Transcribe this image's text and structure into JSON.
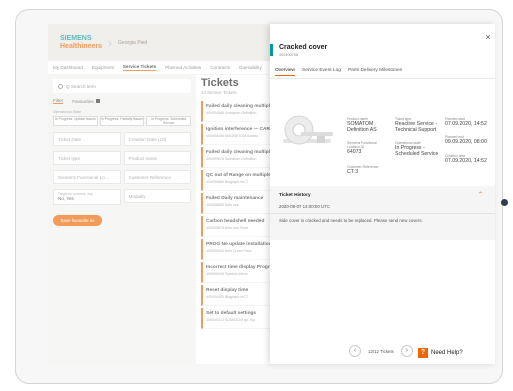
{
  "app": {
    "brand_line1": "SIEMENS",
    "brand_line2": "Healthineers",
    "site": "Georgia Pied"
  },
  "nav": [
    "My Dashboard",
    "Equipment",
    "Service Tickets",
    "Planned Activities",
    "Contracts",
    "Guesability"
  ],
  "nav_active_index": 2,
  "left": {
    "search_placeholder": "Q Search term",
    "filter_tabs": [
      "Filter",
      "Favourites"
    ],
    "operational_state_label": "Operational State",
    "chips": [
      "In Progress: Update Issues",
      "In Progress: Partially Issues",
      "In Progress: Scheduled Service"
    ],
    "fields": [
      [
        "Ticket Date",
        "Creation Date (10)"
      ],
      [
        "Ticket type",
        "Product name"
      ],
      [
        "Siemens Functional Lo...",
        "Customer Reference"
      ],
      [
        "Modality"
      ]
    ],
    "target_field_small": "Target for success, day",
    "target_field_value": "No, Yes",
    "fav_button": "Save favourite as"
  },
  "list": {
    "title": "Tickets",
    "subtitle": "13 Service Tickets",
    "tickets": [
      {
        "title": "Failed daily cleaning multiple...",
        "meta": "400094568   Somatom Definition"
      },
      {
        "title": "Ignition interference — CARD...",
        "meta": "400098208   MAGNETOM Avanto"
      },
      {
        "title": "Failed daily cleaning multiple...",
        "meta": "400099678   Somatom Definition"
      },
      {
        "title": "QC out of Range on multiple...",
        "meta": "400099866   Biograph mCT"
      },
      {
        "title": "Failed Daily maintenance",
        "meta": "400058889   Artis zee"
      },
      {
        "title": "Carbon headshell needed",
        "meta": "400099876   Artis one Floor"
      },
      {
        "title": "PROG No update installation...",
        "meta": "400099943   Artis Q.zen Floor"
      },
      {
        "title": "Incorrect time display Progra...",
        "meta": "400099945   Symbia Intevo"
      },
      {
        "title": "Reset display time",
        "meta": "400050903   Biograph mCT"
      },
      {
        "title": "Set to default settings",
        "meta": "400049213   SOMATOM go.Top"
      }
    ]
  },
  "panel": {
    "title": "Cracked cover",
    "ticket_id": "400100708",
    "close_label": "×",
    "tabs": [
      "Overview",
      "Service Event Log",
      "Parts Delivery Milestones"
    ],
    "active_tab": 0,
    "info": {
      "product_name_label": "Product name",
      "product_name_l1": "SOMATOM",
      "product_name_l2": "Definition AS",
      "ticket_type_label": "Ticket type",
      "ticket_type_l1": "Reactive Service -",
      "ticket_type_l2": "Technical Support",
      "planned_start_label": "Planned start",
      "planned_start": "07.09.2020, 14:52",
      "siemens_loc_label": "Siemens Functional",
      "siemens_loc_label2": "Location ID",
      "siemens_loc": "64073",
      "op_state_label": "Operational state",
      "op_state_l1": "In Progress -",
      "op_state_l2": "Scheduled Service",
      "planned_end_label": "Planned end",
      "planned_end": "09.09.2020, 08:00",
      "creation_time_label": "Creation time",
      "creation_time": "07.09.2020, 14:52",
      "customer_ref_label": "Customer Reference",
      "customer_ref": "CT 3"
    },
    "history": {
      "title": "Ticket History",
      "date": "2020-09-07 14:00:00 UTC",
      "text": "Side cover is cracked and needs to be replaced. Please send new covers."
    },
    "pager": {
      "prev": "‹",
      "label": "12/12 Tickets",
      "next": "›"
    },
    "help": {
      "icon": "?",
      "label": "Need Help?"
    }
  },
  "colors": {
    "accent": "#ec6602",
    "brand": "#009999"
  }
}
